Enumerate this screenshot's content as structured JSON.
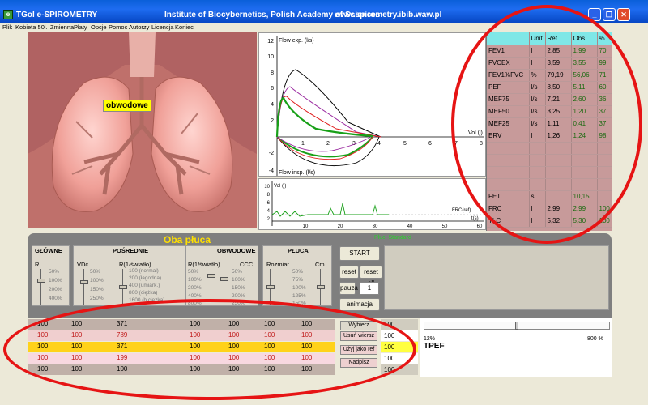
{
  "window": {
    "app_title": "TGol e-SPIROMETRY",
    "institute": "Institute of Biocybernetics, Polish Academy of Sciences",
    "website": "www.spirometry.ibib.waw.pl",
    "minimize": "_",
    "restore": "❐",
    "close": "✕"
  },
  "menu": [
    "Plik",
    "Kobieta 50l.",
    "Zmienna",
    "Płaty",
    "Opcje",
    "Pomoc",
    "Autorzy",
    "Licencja",
    "Koniec"
  ],
  "lung": {
    "label": "obwodowe"
  },
  "flow_graph": {
    "ylabel": "Flow exp. (l/s)",
    "ylabel_insp": "Flow insp. (l/s)",
    "xlabel": "Vol (l)",
    "yticks": [
      "12",
      "10",
      "8",
      "6",
      "4",
      "2",
      "-2",
      "-4"
    ],
    "xticks": [
      "1",
      "2",
      "3",
      "4",
      "5",
      "6",
      "7",
      "8"
    ]
  },
  "volume_graph": {
    "ylabel": "Vol (l)",
    "xlabel": "t(s)",
    "frc_label": "FRC(ref)",
    "yticks": [
      "10",
      "8",
      "6",
      "4",
      "2"
    ],
    "xticks": [
      "10",
      "20",
      "30",
      "40",
      "50",
      "60"
    ]
  },
  "param_table": {
    "headers": [
      "",
      "Unit",
      "Ref.",
      "Obs.",
      "%"
    ],
    "rows": [
      [
        "FEV1",
        "l",
        "2,85",
        "1,99",
        "70"
      ],
      [
        "FVCEX",
        "l",
        "3,59",
        "3,55",
        "99"
      ],
      [
        "FEV1%FVC",
        "%",
        "79,19",
        "56,06",
        "71"
      ],
      [
        "PEF",
        "l/s",
        "8,50",
        "5,11",
        "60"
      ],
      [
        "MEF75",
        "l/s",
        "7,21",
        "2,60",
        "36"
      ],
      [
        "MEF50",
        "l/s",
        "3,25",
        "1,20",
        "37"
      ],
      [
        "MEF25",
        "l/s",
        "1,11",
        "0,41",
        "37"
      ],
      [
        "ERV",
        "l",
        "1,26",
        "1,24",
        "98"
      ],
      [
        "",
        "",
        "",
        "",
        ""
      ],
      [
        "",
        "",
        "",
        "",
        ""
      ],
      [
        "",
        "",
        "",
        "",
        ""
      ],
      [
        "",
        "",
        "",
        "",
        ""
      ],
      [
        "FET",
        "s",
        "",
        "10,15",
        ""
      ],
      [
        "FRC",
        "l",
        "2,99",
        "2,99",
        "100"
      ],
      [
        "TLC",
        "l",
        "5,32",
        "5,30",
        "100"
      ]
    ]
  },
  "panel": {
    "title": "Oba płuca",
    "subtitle": "Płuc. Standard",
    "groups": {
      "glowne": {
        "title": "GŁÓWNE",
        "param": "R",
        "ticks": [
          "50%",
          "100%",
          "200%",
          "400%"
        ]
      },
      "posrednie": {
        "title": "POŚREDNIE",
        "param_a": "VDc",
        "param_b": "R(1/światło)",
        "ticks_a": [
          "50%",
          "100%",
          "150%",
          "250%"
        ],
        "ticks_b": [
          "100 (normal)",
          "200 (łagodna)",
          "400 (umiark.)",
          "800 (ciężka)",
          "1600 (b.ciężka)"
        ]
      },
      "obwodowe": {
        "title": "OBWODOWE",
        "param_a": "R(1/światło)",
        "param_b": "CCC",
        "ticks_a": [
          "50%",
          "100%",
          "200%",
          "400%",
          "800%"
        ],
        "ticks_b": [
          "50%",
          "100%",
          "150%",
          "200%",
          "250%"
        ]
      },
      "pluca": {
        "title": "PŁUCA",
        "param_a": "Rozmiar",
        "param_b": "Cm",
        "ticks": [
          "50%",
          "75%",
          "100%",
          "125%",
          "150%"
        ]
      }
    },
    "buttons": {
      "start": "START",
      "reset": "reset",
      "reset_all": "reset all",
      "pause": "pauza",
      "pause_value": "1",
      "animation": "animacja"
    }
  },
  "grid": {
    "rows": [
      [
        "100",
        "100",
        "371",
        "",
        "100",
        "100",
        "100",
        "100"
      ],
      [
        "100",
        "100",
        "789",
        "",
        "100",
        "100",
        "100",
        "100"
      ],
      [
        "100",
        "100",
        "371",
        "",
        "100",
        "100",
        "100",
        "100"
      ],
      [
        "100",
        "100",
        "199",
        "",
        "100",
        "100",
        "100",
        "100"
      ],
      [
        "100",
        "100",
        "100",
        "",
        "100",
        "100",
        "100",
        "100"
      ]
    ],
    "right_values": [
      "100",
      "100",
      "100",
      "100",
      "100"
    ],
    "buttons": {
      "select": "Wybierz wiersz",
      "delete": "Usuń wiersz",
      "use_as_ref": "Użyj jako ref",
      "overwrite": "Nadpisz"
    }
  },
  "tpef": {
    "title": "TPEF",
    "min_label": "12%",
    "max_label": "800 %"
  },
  "colors": {
    "accent": "#ffe000",
    "highlight_ellipse": "#e61414",
    "lung_tint": "#a05656",
    "table_header": "#7fe7e7"
  }
}
